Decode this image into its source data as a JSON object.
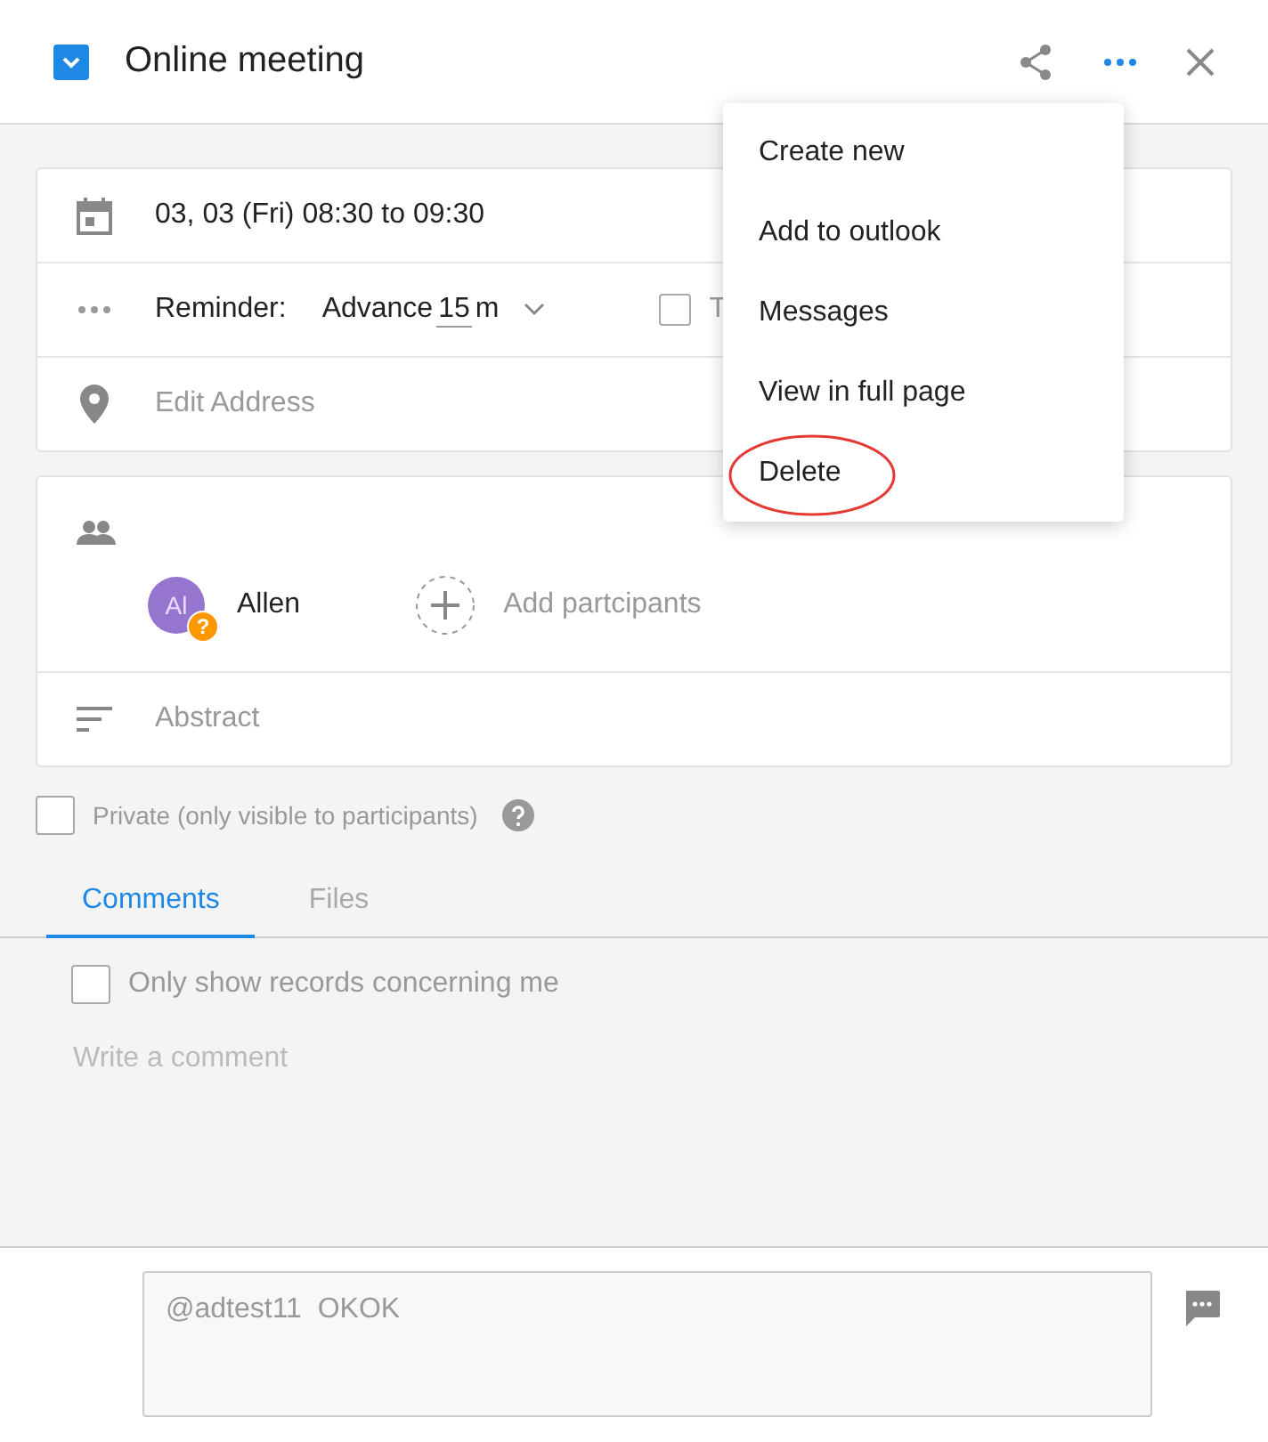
{
  "header": {
    "checked": true,
    "title": "Online meeting"
  },
  "details": {
    "date": "03, 03 (Fri) 08:30 to 09:30",
    "reminder_label": "Reminder:",
    "reminder_prefix": "Advance",
    "reminder_value": "15",
    "reminder_unit": "m",
    "option_checked": false,
    "option_label": "T",
    "address_placeholder": "Edit Address"
  },
  "participants": [
    {
      "initials": "Al",
      "name": "Allen",
      "badge": "?",
      "color": "#9575cd"
    }
  ],
  "add_participants": "Add partcipants",
  "abstract_placeholder": "Abstract",
  "private": {
    "checked": false,
    "label": "Private (only visible to participants)"
  },
  "tabs": [
    {
      "label": "Comments",
      "selected": true
    },
    {
      "label": "Files",
      "selected": false
    }
  ],
  "filter": {
    "checked": false,
    "label": "Only show records concerning me"
  },
  "empty_comment_text": "Write a comment",
  "comment_input": {
    "value": "@adtest11  OKOK"
  },
  "menu": [
    {
      "label": "Create new",
      "circled": false
    },
    {
      "label": "Add to outlook",
      "circled": false
    },
    {
      "label": "Messages",
      "circled": false
    },
    {
      "label": "View in full page",
      "circled": false
    },
    {
      "label": "Delete",
      "circled": true
    }
  ]
}
